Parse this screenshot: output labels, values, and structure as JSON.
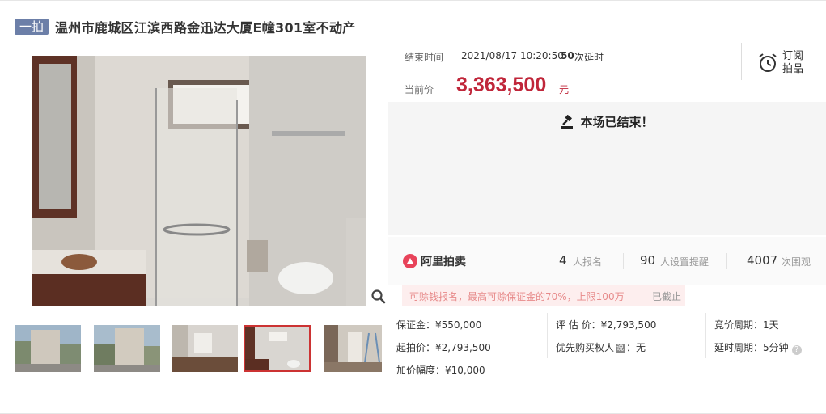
{
  "header": {
    "round_badge": "一拍",
    "title": "温州市鹿城区江滨西路金迅达大厦E幢301室不动产"
  },
  "auction": {
    "end_label": "结束时间",
    "end_time": "2021/08/17 10:20:50",
    "delay_count": "50",
    "delay_label": "次延时",
    "price_label": "当前价",
    "price_value": "3,363,500",
    "price_unit": "元",
    "subscribe_label": "订阅拍品",
    "ended_text": "本场已结束！"
  },
  "stats": {
    "logo_text": "阿里拍卖",
    "signups_num": "4",
    "signups_label": "人报名",
    "reminders_num": "90",
    "reminders_label": "人设置提醒",
    "views_num": "4007",
    "views_label": "次围观"
  },
  "promo": {
    "text": "可赊钱报名，最高可赊保证金的70%，上限100万",
    "status": "已截止"
  },
  "details": {
    "deposit": "保证金：¥550,000",
    "start_price": "起拍价：¥2,793,500",
    "increment": "加价幅度：¥10,000",
    "appraisal": "评 估 价：¥2,793,500",
    "priority_label": "优先购买权人",
    "priority_tag": "说",
    "priority_value": "：无",
    "bid_period": "竞价周期：1天",
    "delay_period": "延时周期：5分钟",
    "help": "?"
  },
  "icons": [
    "auction-hammer-icon",
    "alarm-clock-icon",
    "search-zoom-icon",
    "help-icon",
    "aliauction-logo-icon"
  ],
  "colors": {
    "badge": "#6c7fa8",
    "price": "#c0263a",
    "thumb_active_border": "#cc3333",
    "promo_bg": "#fdeeee",
    "promo_text": "#e78a8a"
  }
}
